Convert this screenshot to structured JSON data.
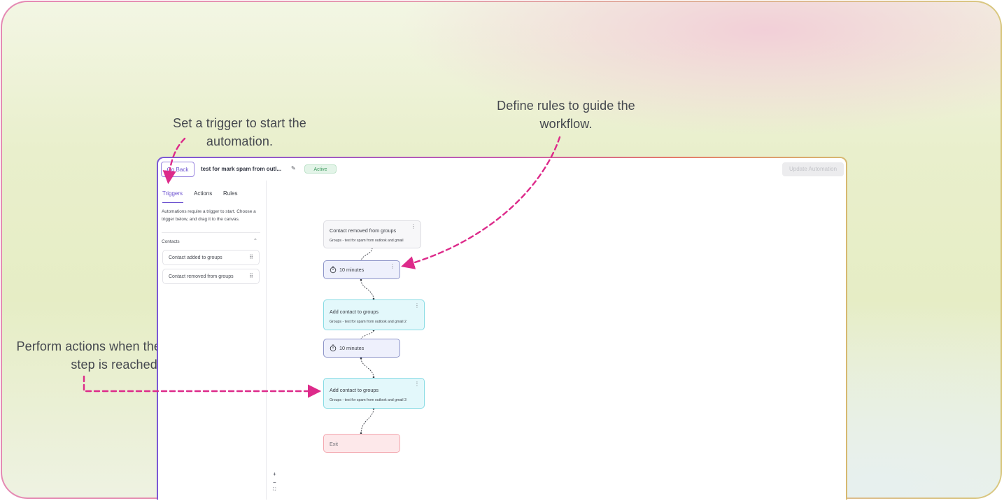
{
  "callouts": {
    "trigger": "Set a trigger to start the automation.",
    "rules": "Define rules to guide the workflow.",
    "actions": "Perform actions when the step is reached."
  },
  "header": {
    "go_back": "Go Back",
    "automation_title": "test for mark spam from outl...",
    "status": "Active",
    "update_button": "Update Automation"
  },
  "sidebar": {
    "tabs": [
      "Triggers",
      "Actions",
      "Rules"
    ],
    "intro": "Automations require a trigger to start. Choose a trigger below, and drag it to the canvas.",
    "section": "Contacts",
    "items": [
      "Contact added to groups",
      "Contact removed from groups"
    ]
  },
  "workflow": {
    "trigger": {
      "title": "Contact removed from groups",
      "detail": "Groups - test for spam from outlook and gmail"
    },
    "delay1": {
      "label": "10 minutes"
    },
    "action1": {
      "title": "Add contact to groups",
      "detail": "Groups - test for spam from outlook and gmail 2"
    },
    "delay2": {
      "label": "10 minutes"
    },
    "action2": {
      "title": "Add contact to groups",
      "detail": "Groups - test for spam from outlook and gmail 3"
    },
    "exit": {
      "label": "Exit"
    }
  },
  "zoom_controls": {
    "zoom_in": "+",
    "zoom_out": "−",
    "fit": "⛶"
  },
  "colors": {
    "accent": "#6a4fcf",
    "annotation": "#dd2a8a",
    "active": "#3d9a5e"
  }
}
